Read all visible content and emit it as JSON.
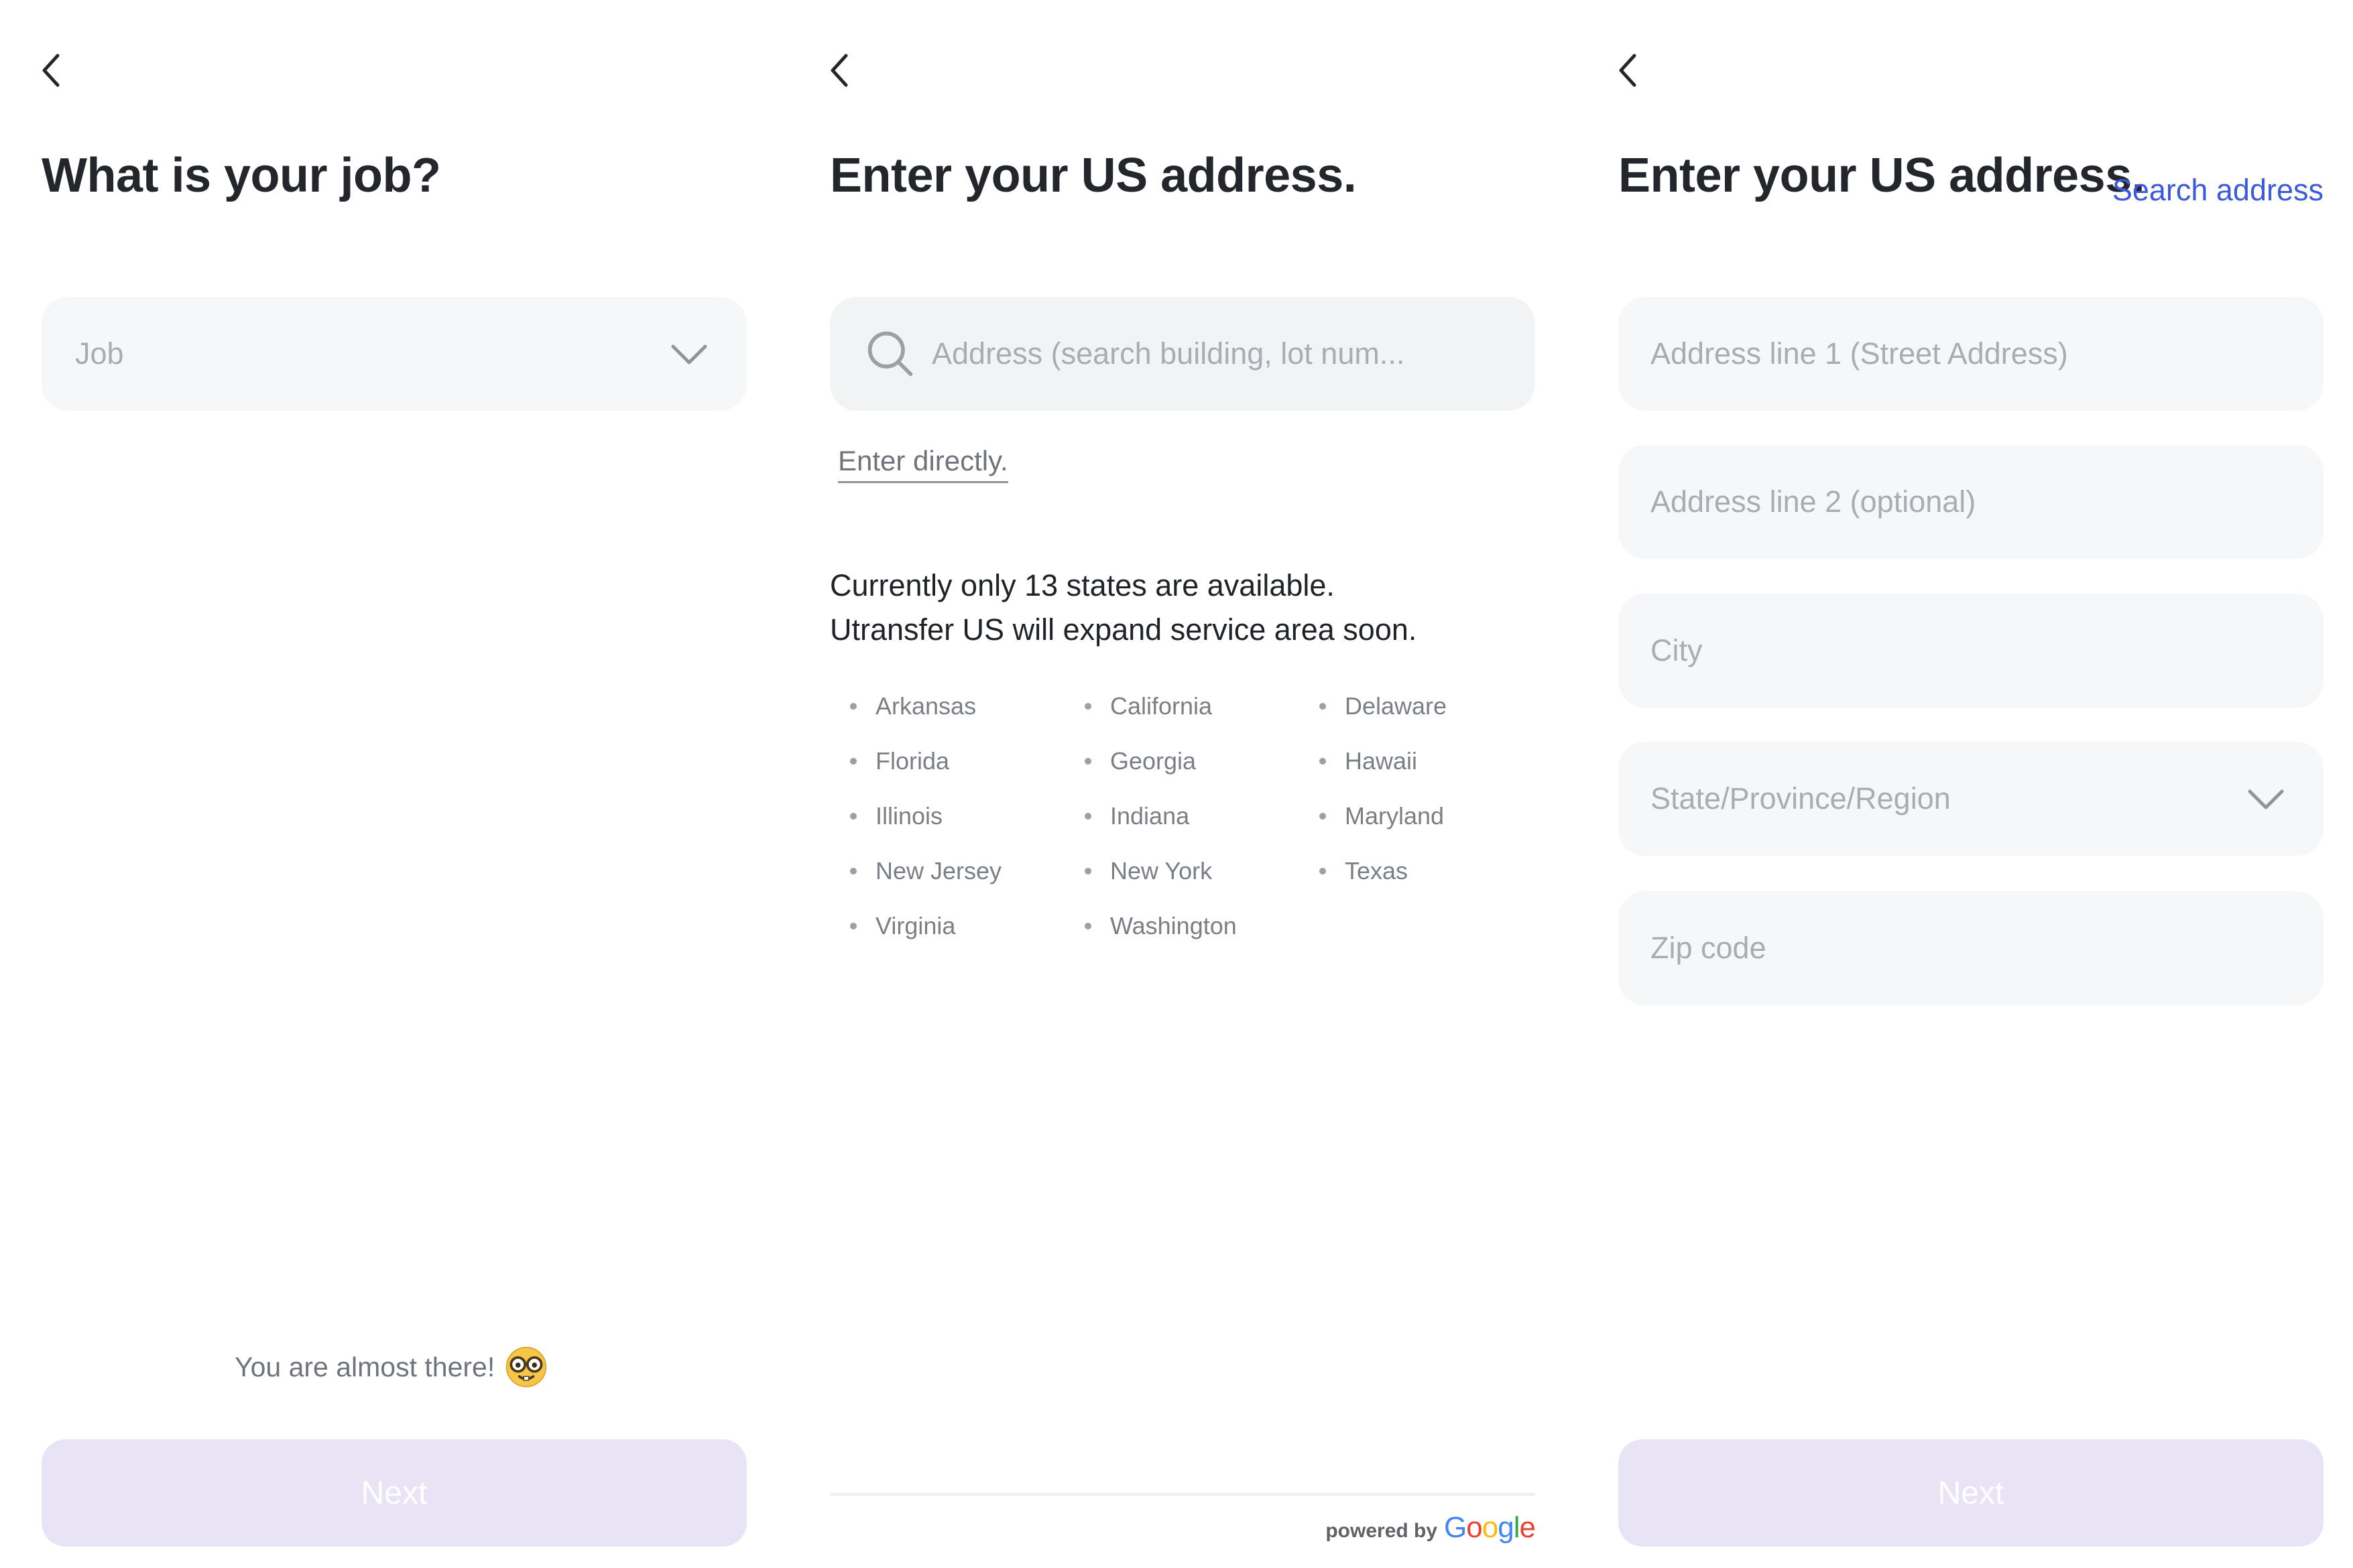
{
  "panel1": {
    "title": "What is your job?",
    "job_placeholder": "Job",
    "almost_text": "You are almost there!",
    "next_label": "Next"
  },
  "panel2": {
    "title": "Enter your US address.",
    "search_placeholder": "Address (search building, lot num...",
    "enter_directly": "Enter directly.",
    "info_line1": "Currently only 13 states are available.",
    "info_line2": "Utransfer US will expand service area soon.",
    "states": [
      "Arkansas",
      "California",
      "Delaware",
      "Florida",
      "Georgia",
      "Hawaii",
      "Illinois",
      "Indiana",
      "Maryland",
      "New Jersey",
      "New York",
      "Texas",
      "Virginia",
      "Washington"
    ],
    "powered_by": "powered by",
    "google": [
      "G",
      "o",
      "o",
      "g",
      "l",
      "e"
    ]
  },
  "panel3": {
    "title": "Enter your US address.",
    "search_address": "Search address",
    "address1_placeholder": "Address line 1 (Street Address)",
    "address2_placeholder": "Address line 2 (optional)",
    "city_placeholder": "City",
    "state_placeholder": "State/Province/Region",
    "zip_placeholder": "Zip code",
    "next_label": "Next"
  },
  "icons": {
    "back": "chevron-left-icon",
    "dropdown": "chevron-down-icon",
    "search": "search-icon",
    "emoji": "nerd-face-emoji-icon"
  },
  "colors": {
    "accent": "#3b5bdb",
    "button_disabled": "#e8e4f5",
    "field_bg": "#f6f7f8",
    "placeholder": "#a8adb3",
    "google_blue": "#4285F4",
    "google_red": "#EA4335",
    "google_yellow": "#FBBC05",
    "google_green": "#34A853"
  }
}
